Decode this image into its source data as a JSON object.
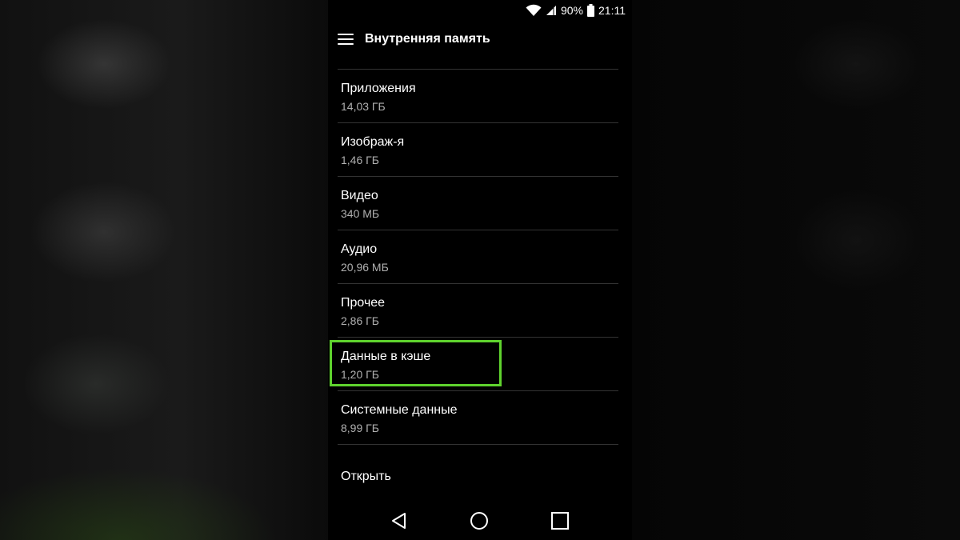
{
  "status_bar": {
    "battery_percent": "90%",
    "time": "21:11",
    "icons": [
      "wifi-icon",
      "cell-signal-icon",
      "battery-icon"
    ]
  },
  "app_bar": {
    "title": "Внутренняя память",
    "menu_icon": "hamburger-menu-icon"
  },
  "storage_items": [
    {
      "label": "Приложения",
      "size": "14,03 ГБ"
    },
    {
      "label": "Изображ-я",
      "size": "1,46 ГБ"
    },
    {
      "label": "Видео",
      "size": "340 МБ"
    },
    {
      "label": "Аудио",
      "size": "20,96 МБ"
    },
    {
      "label": "Прочее",
      "size": "2,86 ГБ"
    },
    {
      "label": "Данные в кэше",
      "size": "1,20 ГБ",
      "highlighted": true
    },
    {
      "label": "Системные данные",
      "size": "8,99 ГБ"
    }
  ],
  "open_label": "Открыть",
  "nav_bar": {
    "buttons": [
      "back-icon",
      "home-icon",
      "recents-icon"
    ]
  },
  "colors": {
    "highlight": "#5fd32e",
    "background": "#000000",
    "divider": "#333333"
  }
}
